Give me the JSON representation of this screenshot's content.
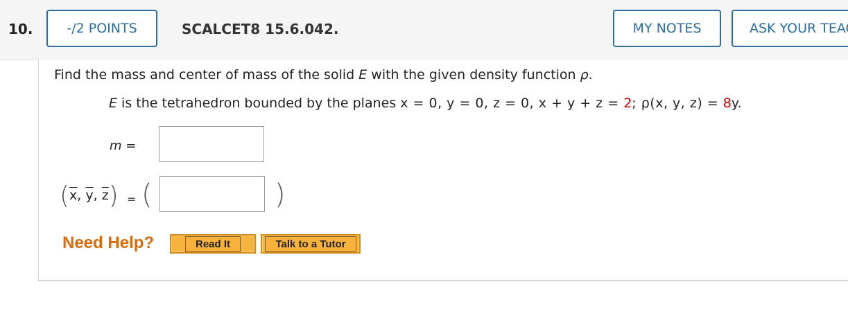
{
  "header": {
    "question_number": "10.",
    "points_label": "-/2 POINTS",
    "question_id": "SCALCET8 15.6.042.",
    "my_notes_label": "MY NOTES",
    "ask_teacher_label": "ASK YOUR TEACHER"
  },
  "question": {
    "prompt_pre": "Find the mass and center of mass of the solid ",
    "prompt_var": "E",
    "prompt_post": " with the given density function ",
    "prompt_rho": "ρ",
    "prompt_end": ".",
    "statement_pre": "E",
    "statement_text": " is the tetrahedron bounded by the planes ",
    "statement_planes": "x = 0,   y = 0,   z = 0,   x + y + z = ",
    "statement_value": "2",
    "statement_sep": ";   ρ(x, y, z) = ",
    "statement_density_coef": "8",
    "statement_density_var": "y."
  },
  "answers": {
    "mass_label": "m =",
    "mass_value": "",
    "com_label_x": "x",
    "com_label_y": "y",
    "com_label_z": "z",
    "com_equals": "=",
    "com_value": ""
  },
  "help": {
    "need_help_label": "Need Help?",
    "read_it_label": "Read It",
    "talk_tutor_label": "Talk to a Tutor"
  },
  "colors": {
    "accent_blue": "#2c6ea3",
    "highlight_red": "#d10000",
    "help_orange": "#d86c0a",
    "button_orange": "#f6b33d"
  }
}
